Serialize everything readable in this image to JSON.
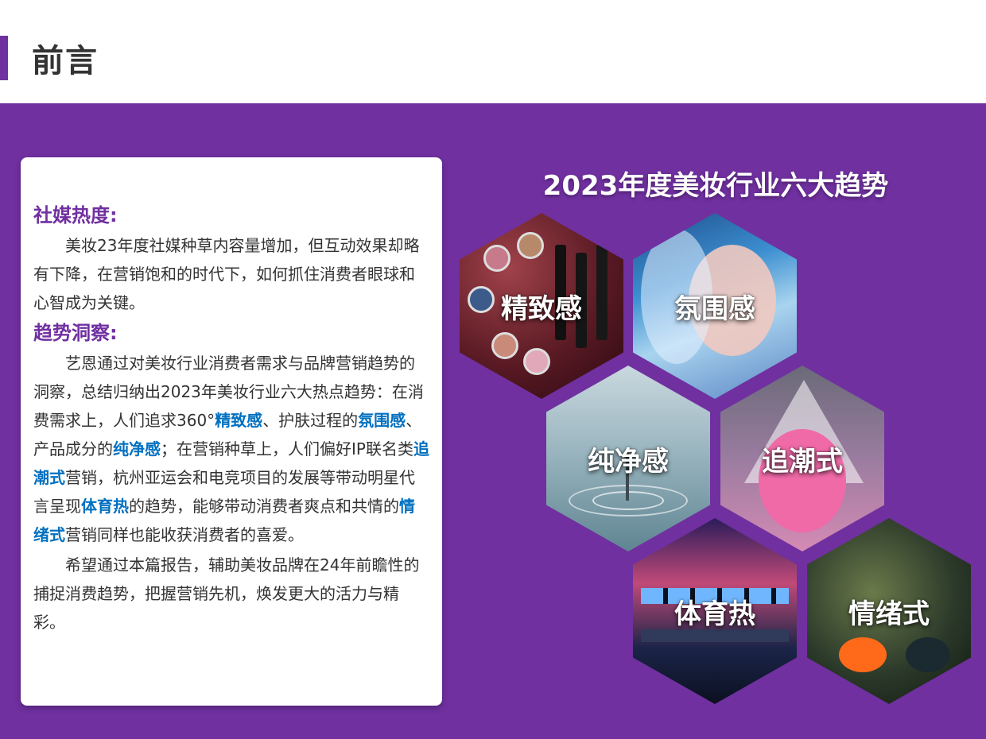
{
  "header": {
    "title": "前言"
  },
  "card": {
    "section1": {
      "title": "社媒热度:",
      "paragraph": "美妆23年度社媒种草内容量增加，但互动效果却略有下降，在营销饱和的时代下，如何抓住消费者眼球和心智成为关键。"
    },
    "section2": {
      "title": "趋势洞察:",
      "p1": {
        "t1": "艺恩通过对美妆行业消费者需求与品牌营销趋势的洞察，总结归纳出2023年美妆行业六大热点趋势：在消费需求上，人们追求360°",
        "h1": "精致感",
        "t2": "、护肤过程的",
        "h2": "氛围感",
        "t3": "、产品成分的",
        "h3": "纯净感",
        "t4": "；在营销种草上，人们偏好IP联名类",
        "h4": "追潮式",
        "t5": "营销，杭州亚运会和电竞项目的发展等带动明星代言呈现",
        "h5": "体育热",
        "t6": "的趋势，能够带动消费者爽点和共情的",
        "h6": "情绪式",
        "t7": "营销同样也能收获消费者的喜爱。"
      },
      "p2": "希望通过本篇报告，辅助美妆品牌在24年前瞻性的捕捉消费趋势，把握营销先机，焕发更大的活力与精彩。"
    }
  },
  "trends": {
    "title": "2023年度美妆行业六大趋势",
    "items": [
      "精致感",
      "氛围感",
      "纯净感",
      "追潮式",
      "体育热",
      "情绪式"
    ]
  },
  "colors": {
    "brand_purple": "#7030a0",
    "highlight_blue": "#0070c0",
    "body_text": "#333333"
  }
}
